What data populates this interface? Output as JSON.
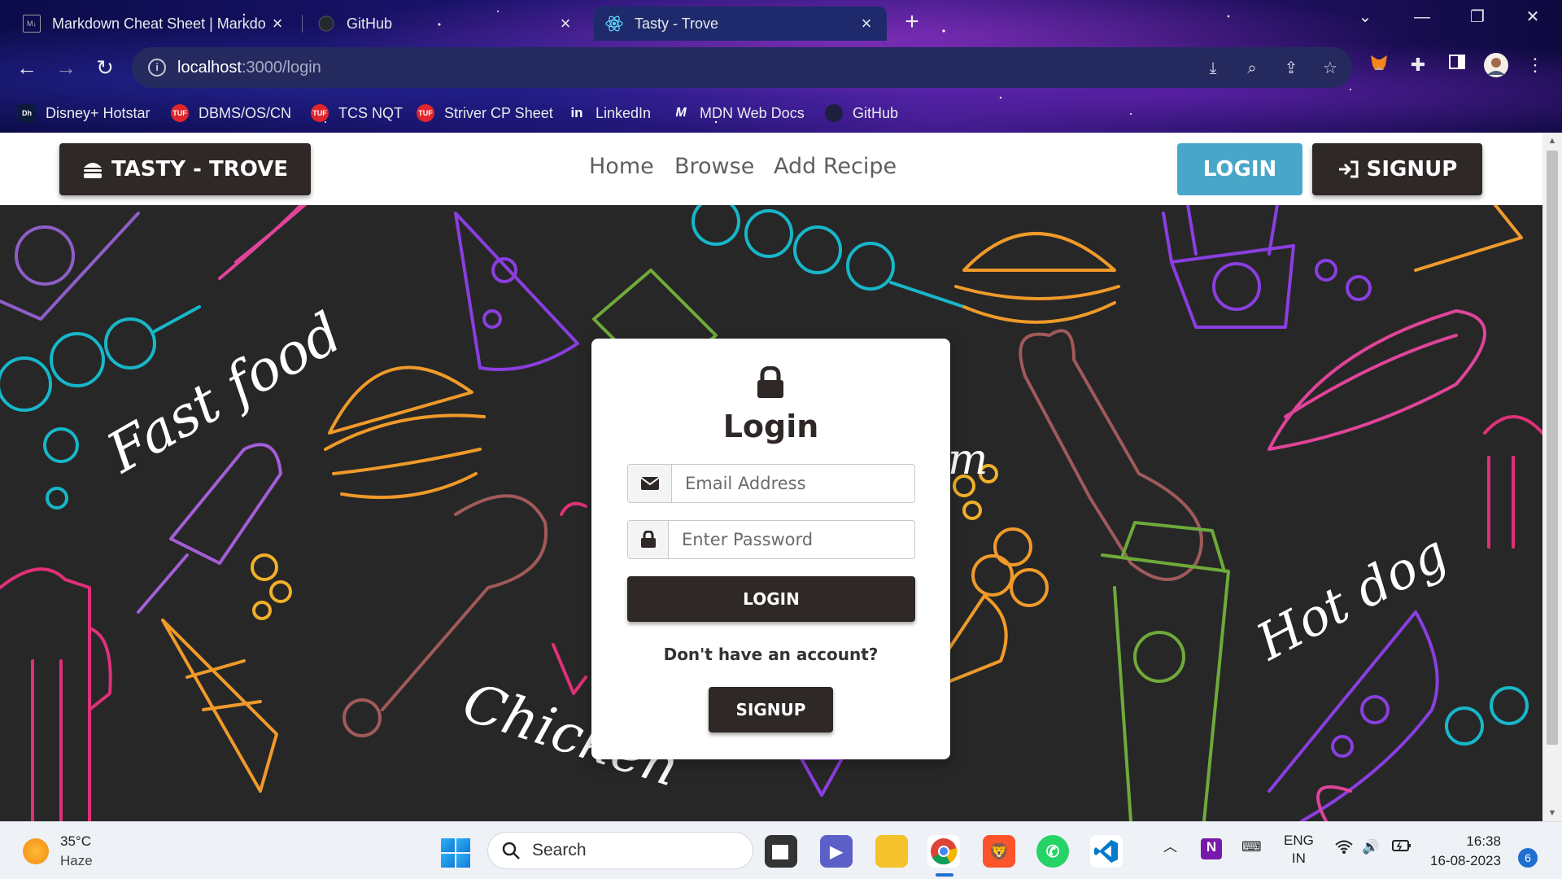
{
  "browser": {
    "tabs": [
      {
        "title": "Markdown Cheat Sheet | Markdo",
        "icon": "markdown-icon",
        "active": false
      },
      {
        "title": "GitHub",
        "icon": "github-icon",
        "active": false
      },
      {
        "title": "Tasty - Trove",
        "icon": "react-icon",
        "active": true
      }
    ],
    "url_host": "localhost",
    "url_path": ":3000/login",
    "bookmarks": [
      {
        "label": "Disney+ Hotstar",
        "icon": "hotstar-icon"
      },
      {
        "label": "DBMS/OS/CN",
        "icon": "tuf-icon"
      },
      {
        "label": "TCS NQT",
        "icon": "tuf-icon"
      },
      {
        "label": "Striver CP Sheet",
        "icon": "tuf-icon"
      },
      {
        "label": "LinkedIn",
        "icon": "linkedin-icon"
      },
      {
        "label": "MDN Web Docs",
        "icon": "mdn-icon"
      },
      {
        "label": "GitHub",
        "icon": "github-icon"
      }
    ],
    "bookmark_icon_text": {
      "hotstar": "Dh",
      "tuf": "TUF",
      "linkedin": "in",
      "mdn": "M"
    }
  },
  "site": {
    "brand": "TASTY - TROVE",
    "nav_links": [
      "Home",
      "Browse",
      "Add Recipe"
    ],
    "login_button": "LOGIN",
    "signup_button": "SIGNUP",
    "colors": {
      "dark": "#2e2826",
      "accent": "#48a7c9"
    }
  },
  "hero_text": {
    "fast_food": "Fast food",
    "hot_dog": "Hot dog",
    "chicken": "Chicken",
    "partial": "m"
  },
  "login": {
    "title": "Login",
    "email_placeholder": "Email Address",
    "password_placeholder": "Enter Password",
    "submit_label": "LOGIN",
    "no_account": "Don't have an account?",
    "signup_label": "SIGNUP"
  },
  "taskbar": {
    "temperature": "35°C",
    "condition": "Haze",
    "search_label": "Search",
    "language_top": "ENG",
    "language_bottom": "IN",
    "time": "16:38",
    "date": "16-08-2023",
    "notifications": "6"
  }
}
